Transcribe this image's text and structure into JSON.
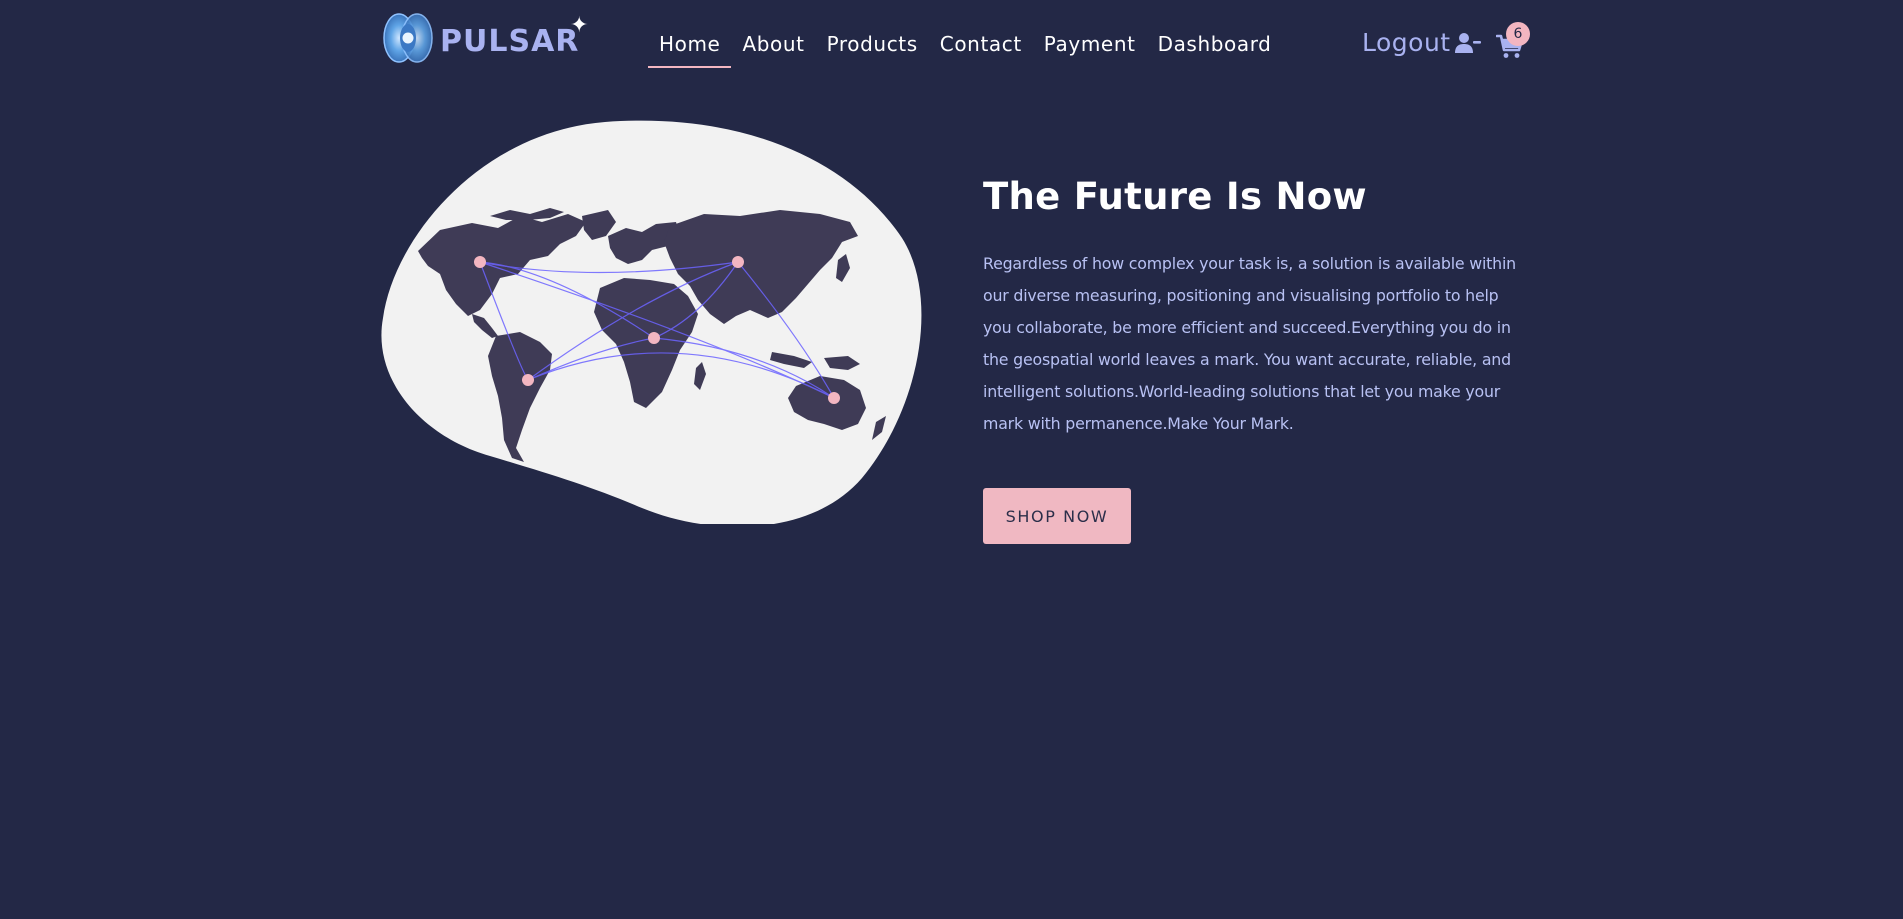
{
  "brand": {
    "name": "PULSAR",
    "logo_icon": "pulsar-logo-icon",
    "spark_glyph": "✦"
  },
  "nav": {
    "links": [
      {
        "label": "Home",
        "active": true
      },
      {
        "label": "About",
        "active": false
      },
      {
        "label": "Products",
        "active": false
      },
      {
        "label": "Contact",
        "active": false
      },
      {
        "label": "Payment",
        "active": false
      },
      {
        "label": "Dashboard",
        "active": false
      }
    ],
    "logout_label": "Logout",
    "logout_icon": "user-minus-icon",
    "cart_icon": "shopping-cart-icon",
    "cart_count": "6"
  },
  "hero": {
    "title": "The Future Is Now",
    "description": "Regardless of how complex your task is, a solution is available within our diverse measuring, positioning and visualising portfolio to help you collaborate, be more efficient and succeed.Everything you do in the geospatial world leaves a mark. You want accurate, reliable, and intelligent solutions.World-leading solutions that let you make your mark with permanence.Make Your Mark.",
    "cta_label": "SHOP NOW",
    "illustration": "world-map-network-illustration"
  },
  "colors": {
    "background": "#232846",
    "accent_pink": "#f3b6c1",
    "text_light_blue": "#b8c1f3",
    "brand_blue": "#a9b2f0",
    "blob": "#f2f2f2",
    "continents": "#3f3b56",
    "route_lines": "#6c63ff"
  }
}
